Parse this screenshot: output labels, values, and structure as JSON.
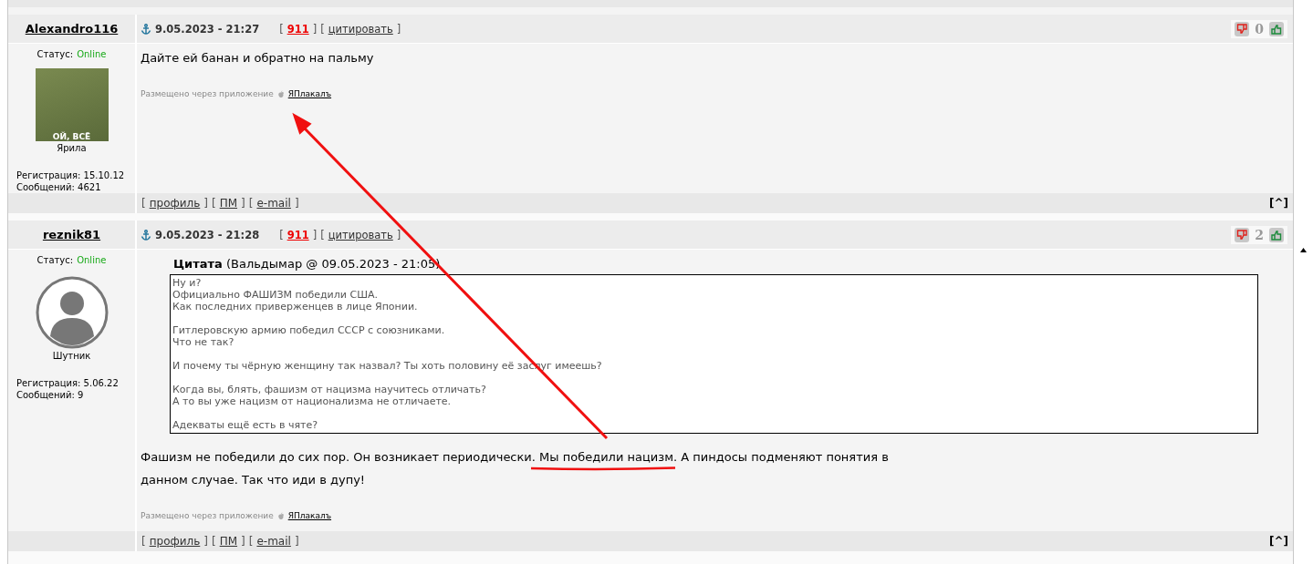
{
  "posts": [
    {
      "author": "Alexandro116",
      "date": "9.05.2023 - 21:27",
      "rating": {
        "before": "[",
        "text": "911",
        "after": "]"
      },
      "quote_link": {
        "before": "[",
        "text": "цитировать",
        "after": "]"
      },
      "votes": "0",
      "status_label": "Статус:",
      "status": "Online",
      "avatar": {
        "kind": "photo",
        "caption": "ОЙ, ВСЁ"
      },
      "rank": "Ярила",
      "registration": "Регистрация: 15.10.12",
      "messages": "Сообщений: 4621",
      "body_lines": [
        "Дайте ей банан и обратно на пальму"
      ],
      "via": "Размещено через приложение",
      "app": "ЯПлакалъ",
      "links": [
        {
          "before": "[",
          "text": "профиль",
          "after": "]"
        },
        {
          "before": "[",
          "text": "ПМ",
          "after": "]"
        },
        {
          "before": "[",
          "text": "e-mail",
          "after": "]"
        }
      ],
      "top_link": "[^]"
    },
    {
      "author": "reznik81",
      "date": "9.05.2023 - 21:28",
      "rating": {
        "before": "[",
        "text": "911",
        "after": "]"
      },
      "quote_link": {
        "before": "[",
        "text": "цитировать",
        "after": "]"
      },
      "votes": "2",
      "status_label": "Статус:",
      "status": "Online",
      "avatar": {
        "kind": "silhouette"
      },
      "rank": "Шутник",
      "registration": "Регистрация: 5.06.22",
      "messages": "Сообщений: 9",
      "quote": {
        "label": "Цитата",
        "source": "(Вальдымар @ 09.05.2023 - 21:05)",
        "paragraphs": [
          [
            "Ну и?",
            "Официально ФАШИЗМ победили США.",
            "Как последних приверженцев в лице Японии."
          ],
          [
            "Гитлеровскую армию победил СССР с союзниками.",
            "Что не так?"
          ],
          [
            "И почему ты чёрную женщину так назвал? Ты хоть половину её заслуг имеешь?"
          ],
          [
            "Когда вы, блять, фашизм от нацизма научитесь отличать?",
            "А то вы уже нацизм от национализма не отличаете."
          ],
          [
            "Адекваты ещё есть в чяте?"
          ]
        ]
      },
      "body_lines": [
        "Фашизм не победили до сих пор. Он возникает периодически. Мы победили нацизм. А пиндосы подменяют понятия в",
        "данном случае. Так что иди в дупу!"
      ],
      "via": "Размещено через приложение",
      "app": "ЯПлакалъ",
      "links": [
        {
          "before": "[",
          "text": "профиль",
          "after": "]"
        },
        {
          "before": "[",
          "text": "ПМ",
          "after": "]"
        },
        {
          "before": "[",
          "text": "e-mail",
          "after": "]"
        }
      ],
      "top_link": "[^]"
    }
  ]
}
